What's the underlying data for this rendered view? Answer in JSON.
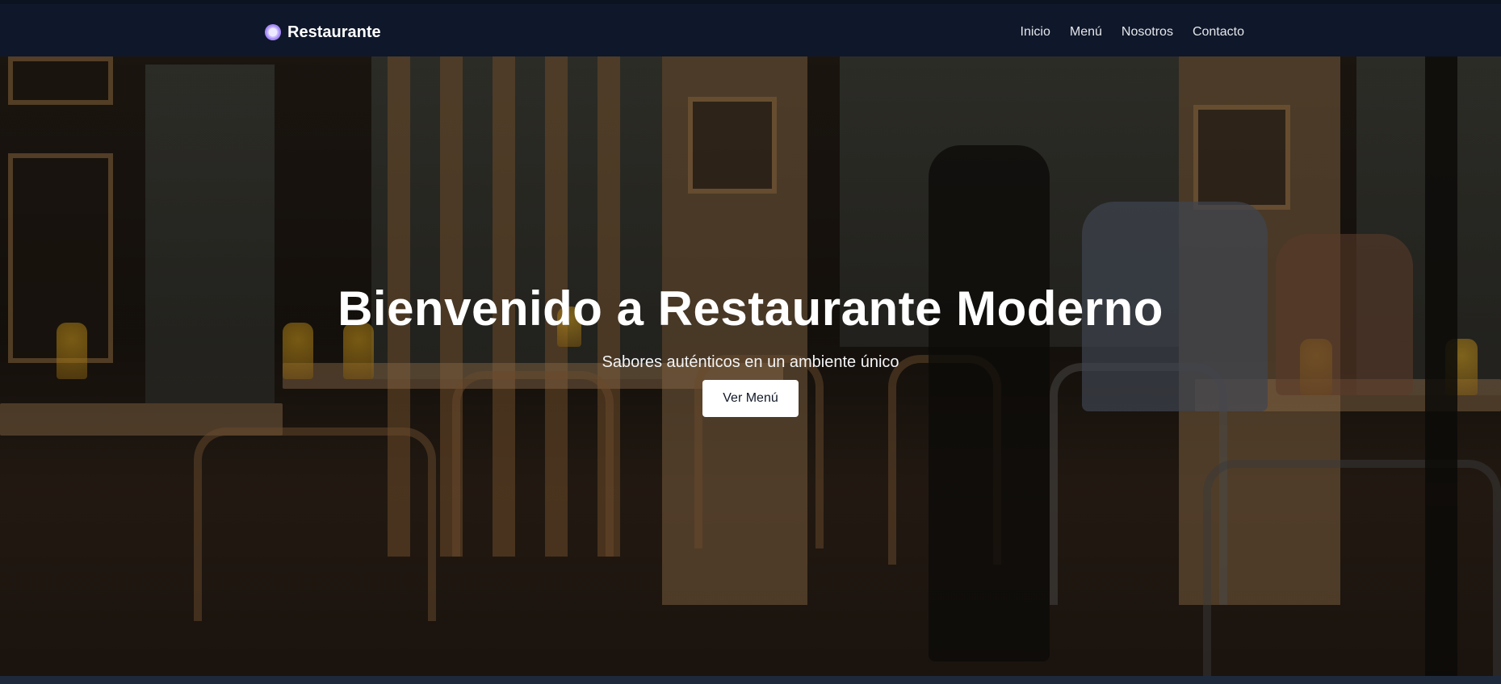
{
  "navbar": {
    "brand": {
      "icon": "plate-icon",
      "name": "Restaurante"
    },
    "links": [
      "Inicio",
      "Menú",
      "Nosotros",
      "Contacto"
    ]
  },
  "hero": {
    "title": "Bienvenido a Restaurante Moderno",
    "subtitle": "Sabores auténticos en un ambiente único",
    "button_label": "Ver Menú"
  },
  "colors": {
    "navbar_bg": "#0f172a",
    "button_bg": "#ffffff",
    "text_primary": "#ffffff"
  }
}
